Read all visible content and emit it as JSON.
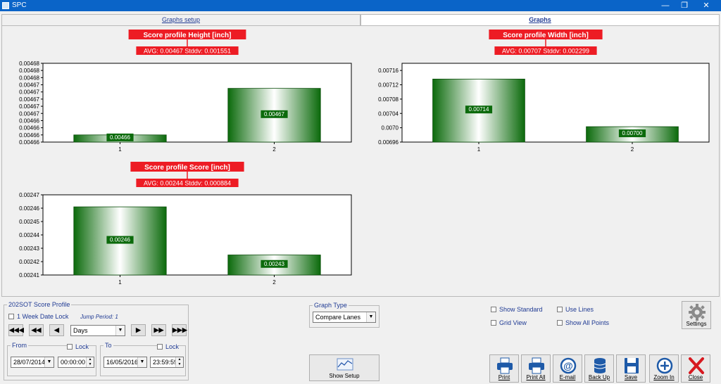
{
  "window": {
    "title": "SPC",
    "minimize": "—",
    "restore": "❐",
    "close": "✕"
  },
  "tabs": [
    {
      "label": "Graphs setup",
      "active": false
    },
    {
      "label": "Graphs",
      "active": true
    }
  ],
  "charts": [
    {
      "id": "height",
      "title": "Score profile Height  [inch]",
      "stats": "AVG: 0.00467 Stddv: 0.001551",
      "chart_data": {
        "type": "bar",
        "categories": [
          "1",
          "2"
        ],
        "values": [
          0.004661,
          0.004674
        ],
        "value_labels": [
          "0.00466",
          "0.00467"
        ],
        "ylim": [
          0.004659,
          0.004681
        ],
        "yticks": [
          0.004659,
          0.004661,
          0.004663,
          0.004665,
          0.004667,
          0.004669,
          0.004671,
          0.004673,
          0.004675,
          0.004677,
          0.004679,
          0.004681
        ],
        "ytick_labels": [
          "0.00466",
          "0.00466",
          "0.00466",
          "0.00466",
          "0.00467",
          "0.00467",
          "0.00467",
          "0.00467",
          "0.00467",
          "0.00468",
          "0.00468",
          "0.00468"
        ]
      }
    },
    {
      "id": "width",
      "title": "Score profile Width  [inch]",
      "stats": "AVG: 0.00707 Stddv: 0.002299",
      "chart_data": {
        "type": "bar",
        "categories": [
          "1",
          "2"
        ],
        "values": [
          0.007136,
          0.007003
        ],
        "value_labels": [
          "0.00714",
          "0.00700"
        ],
        "ylim": [
          0.00696,
          0.00718
        ],
        "yticks": [
          0.00696,
          0.007,
          0.00704,
          0.00708,
          0.00712,
          0.00716
        ],
        "ytick_labels": [
          "0.00696",
          "0.0070",
          "0.00704",
          "0.00708",
          "0.00712",
          "0.00716"
        ]
      }
    },
    {
      "id": "score",
      "title": "Score profile Score  [inch]",
      "stats": "AVG: 0.00244 Stddv: 0.000884",
      "chart_data": {
        "type": "bar",
        "categories": [
          "1",
          "2"
        ],
        "values": [
          0.002461,
          0.002425
        ],
        "value_labels": [
          "0.00246",
          "0.00243"
        ],
        "ylim": [
          0.00241,
          0.00247
        ],
        "yticks": [
          0.00241,
          0.00242,
          0.00243,
          0.00244,
          0.00245,
          0.00246,
          0.00247
        ],
        "ytick_labels": [
          "0.00241",
          "0.00242",
          "0.00243",
          "0.00244",
          "0.00245",
          "0.00246",
          "0.00247"
        ]
      }
    }
  ],
  "score_profile": {
    "title": "202SOT Score Profile",
    "week_lock": "1 Week Date Lock",
    "jump_period": "Jump Period: 1",
    "nav_first": "◀◀◀",
    "nav_prev_fast": "◀◀",
    "nav_prev": "◀",
    "period": "Days",
    "nav_next": "▶",
    "nav_next_fast": "▶▶",
    "nav_last": "▶▶▶",
    "from_title": "From",
    "to_title": "To",
    "lock_label": "Lock",
    "from_date": "28/07/2014",
    "from_time": "00:00:00",
    "to_date": "16/05/2016",
    "to_time": "23:59:59"
  },
  "graph_type": {
    "title": "Graph Type",
    "value": "Compare Lanes"
  },
  "options": {
    "show_standard": "Show Standard",
    "grid_view": "Grid View",
    "use_lines": "Use Lines",
    "show_all_points": "Show All Points"
  },
  "buttons": {
    "settings": "Settings",
    "show_setup": "Show Setup",
    "print": "Print",
    "print_all": "Print All",
    "email": "E-mail",
    "backup": "Back Up",
    "save": "Save",
    "zoom_in": "Zoom In",
    "close": "Close"
  },
  "colors": {
    "bar_dark": "#0b6a0b",
    "bar_light": "#ffffff",
    "title_red": "#ed1c24",
    "titlebar": "#0a64c8"
  }
}
